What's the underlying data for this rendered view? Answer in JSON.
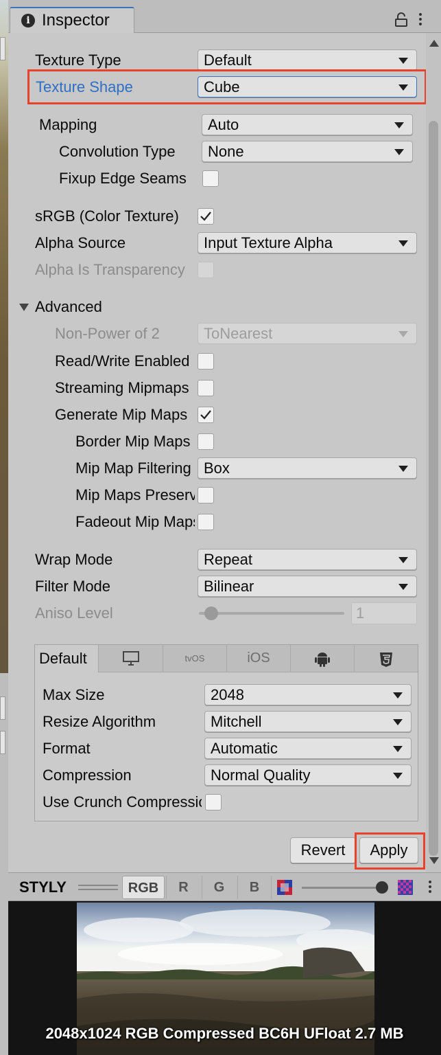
{
  "tab": {
    "title": "Inspector"
  },
  "fields": {
    "texture_type": {
      "label": "Texture Type",
      "value": "Default"
    },
    "texture_shape": {
      "label": "Texture Shape",
      "value": "Cube"
    },
    "mapping": {
      "label": "Mapping",
      "value": "Auto"
    },
    "convolution_type": {
      "label": "Convolution Type",
      "value": "None"
    },
    "fixup_edge_seams": {
      "label": "Fixup Edge Seams",
      "checked": false
    },
    "srgb": {
      "label": "sRGB (Color Texture)",
      "checked": true
    },
    "alpha_source": {
      "label": "Alpha Source",
      "value": "Input Texture Alpha"
    },
    "alpha_is_transparency": {
      "label": "Alpha Is Transparency",
      "checked": false,
      "disabled": true
    }
  },
  "advanced": {
    "header": "Advanced",
    "expanded": true,
    "non_power_of_2": {
      "label": "Non-Power of 2",
      "value": "ToNearest",
      "disabled": true
    },
    "read_write": {
      "label": "Read/Write Enabled",
      "checked": false
    },
    "streaming_mipmaps": {
      "label": "Streaming Mipmaps",
      "checked": false
    },
    "generate_mip_maps": {
      "label": "Generate Mip Maps",
      "checked": true
    },
    "border_mip_maps": {
      "label": "Border Mip Maps",
      "checked": false
    },
    "mip_map_filtering": {
      "label": "Mip Map Filtering",
      "value": "Box"
    },
    "mip_maps_preserve": {
      "label": "Mip Maps Preserve Coverage",
      "checked": false
    },
    "fadeout_mip_maps": {
      "label": "Fadeout Mip Maps",
      "checked": false
    }
  },
  "wrap": {
    "wrap_mode": {
      "label": "Wrap Mode",
      "value": "Repeat"
    },
    "filter_mode": {
      "label": "Filter Mode",
      "value": "Bilinear"
    },
    "aniso_level": {
      "label": "Aniso Level",
      "value": "1",
      "slider_fraction": 0.0
    }
  },
  "platform": {
    "tabs": [
      {
        "label": "Default",
        "icon": ""
      },
      {
        "label": "",
        "icon": "monitor-icon"
      },
      {
        "label": "tvOS",
        "icon": ""
      },
      {
        "label": "iOS",
        "icon": ""
      },
      {
        "label": "",
        "icon": "android-icon"
      },
      {
        "label": "",
        "icon": "html5-icon"
      }
    ],
    "max_size": {
      "label": "Max Size",
      "value": "2048"
    },
    "resize_algorithm": {
      "label": "Resize Algorithm",
      "value": "Mitchell"
    },
    "format": {
      "label": "Format",
      "value": "Automatic"
    },
    "compression": {
      "label": "Compression",
      "value": "Normal Quality"
    },
    "use_crunch": {
      "label": "Use Crunch Compression",
      "checked": false
    }
  },
  "buttons": {
    "revert": "Revert",
    "apply": "Apply"
  },
  "preview": {
    "title": "STYLY",
    "channels": [
      "RGB",
      "R",
      "G",
      "B"
    ],
    "mip_slider_fraction": 1.0,
    "info": "2048x1024  RGB Compressed BC6H UFloat   2.7 MB"
  },
  "colors": {
    "highlight": "#e8432a",
    "label_accent": "#2f6fc4",
    "tab_accent": "#3a72c4"
  }
}
